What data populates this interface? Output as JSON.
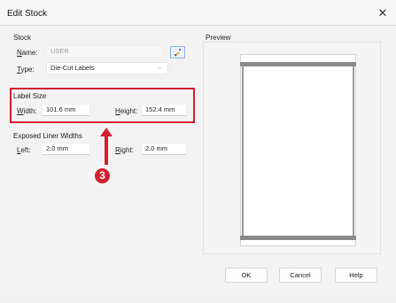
{
  "window": {
    "title": "Edit Stock",
    "close_glyph": "✕"
  },
  "stock": {
    "section_label": "Stock",
    "name_label_u": "N",
    "name_label_rest": "ame:",
    "name_value": "USER",
    "type_label_u": "T",
    "type_label_pre": "",
    "type_label_rest": "ype:",
    "type_value": "Die-Cut Labels",
    "edit_icon": "edit-pencil-icon"
  },
  "label_size": {
    "section_label": "Label Size",
    "width_label_u": "W",
    "width_label_rest": "idth:",
    "width_value": "101.6 mm",
    "height_label_u": "H",
    "height_label_rest": "eight:",
    "height_value": "152.4 mm"
  },
  "liner": {
    "section_label": "Exposed Liner Widths",
    "left_label_u": "L",
    "left_label_rest": "eft:",
    "left_value": "2.0 mm",
    "right_label_u": "R",
    "right_label_rest": "ight:",
    "right_value": "2.0 mm"
  },
  "preview": {
    "section_label": "Preview"
  },
  "annotation": {
    "badge": "3",
    "color": "#d21f2f"
  },
  "buttons": {
    "ok": "OK",
    "cancel": "Cancel",
    "help": "Help"
  }
}
